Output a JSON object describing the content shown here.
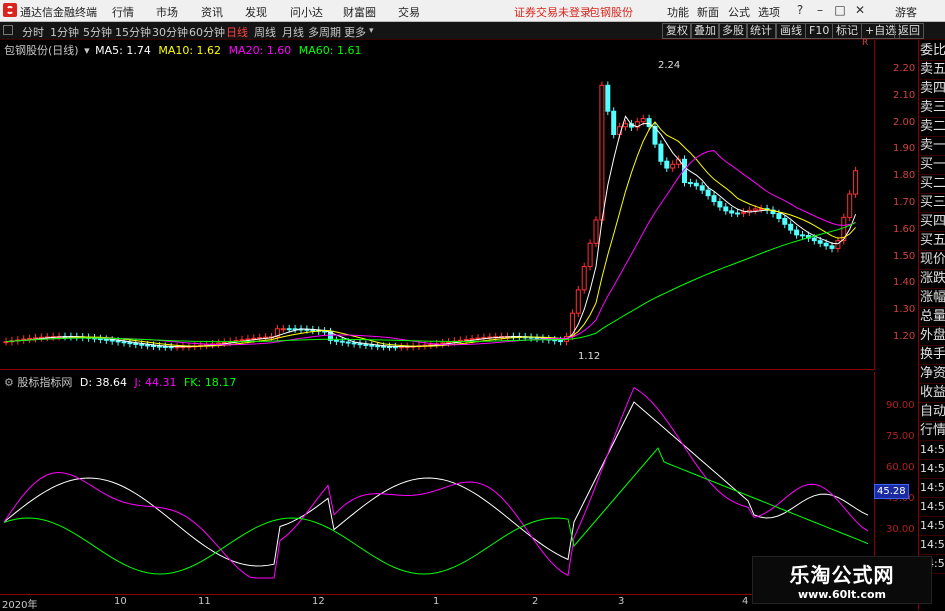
{
  "menubar": {
    "title": "通达信金融终端",
    "items": [
      "行情",
      "市场",
      "资讯",
      "发现",
      "问小达",
      "财富圈",
      "交易"
    ],
    "notice": "证券交易未登录",
    "stock_name": "包钢股份",
    "right_items": [
      "功能",
      "新面",
      "公式",
      "选项"
    ],
    "guest": "游客"
  },
  "toolbar": {
    "periods": [
      "分时",
      "1分钟",
      "5分钟",
      "15分钟",
      "30分钟",
      "60分钟",
      "日线",
      "周线",
      "月线",
      "多周期",
      "更多"
    ],
    "active": "日线",
    "buttons": [
      "复权",
      "叠加",
      "多股",
      "统计",
      "画线",
      "F10",
      "标记",
      "+自选",
      "返回"
    ]
  },
  "main_chart": {
    "legend_name": "包钢股份(日线)",
    "ma": [
      {
        "label": "MA5: 1.74",
        "color": "#ffffff"
      },
      {
        "label": "MA10: 1.62",
        "color": "#ffff00"
      },
      {
        "label": "MA20: 1.60",
        "color": "#ff00ff"
      },
      {
        "label": "MA60: 1.61",
        "color": "#00ff00"
      }
    ],
    "high_label": "2.24",
    "low_label": "1.12",
    "y_ticks": [
      "2.20",
      "2.10",
      "2.00",
      "1.90",
      "1.80",
      "1.70",
      "1.60",
      "1.50",
      "1.40",
      "1.30",
      "1.20"
    ],
    "y_unit": "R"
  },
  "sub_chart": {
    "legend_name": "股标指标网",
    "items": [
      {
        "label": "D: 38.64",
        "color": "#ffffff"
      },
      {
        "label": "J: 44.31",
        "color": "#ff00ff"
      },
      {
        "label": "FK: 18.17",
        "color": "#00ff00"
      }
    ],
    "y_ticks": [
      "90.00",
      "75.00",
      "60.00",
      "45.00",
      "30.00"
    ],
    "current_badge": "45.28"
  },
  "x_axis": {
    "labels": [
      "2020年",
      "10",
      "11",
      "12",
      "1",
      "2",
      "3",
      "4"
    ]
  },
  "side_panel": {
    "items": [
      "委比",
      "卖五",
      "卖四",
      "卖三",
      "卖二",
      "卖一",
      "买一",
      "买二",
      "买三",
      "买四",
      "买五",
      "现价",
      "涨跌",
      "涨幅",
      "总量",
      "外盘",
      "换手",
      "净资",
      "收益",
      "自动",
      "行情",
      "14:50",
      "14:50",
      "14:50",
      "14:50",
      "14:50",
      "14:50",
      "14:50"
    ]
  },
  "watermark": {
    "title": "乐淘公式网",
    "url": "www.60lt.com"
  },
  "colors": {
    "up": "#ff3030",
    "down": "#54ffff",
    "ma5": "#ffffff",
    "ma10": "#ffff00",
    "ma20": "#ff00ff",
    "ma60": "#00ff00",
    "frame": "#8b0000"
  }
}
